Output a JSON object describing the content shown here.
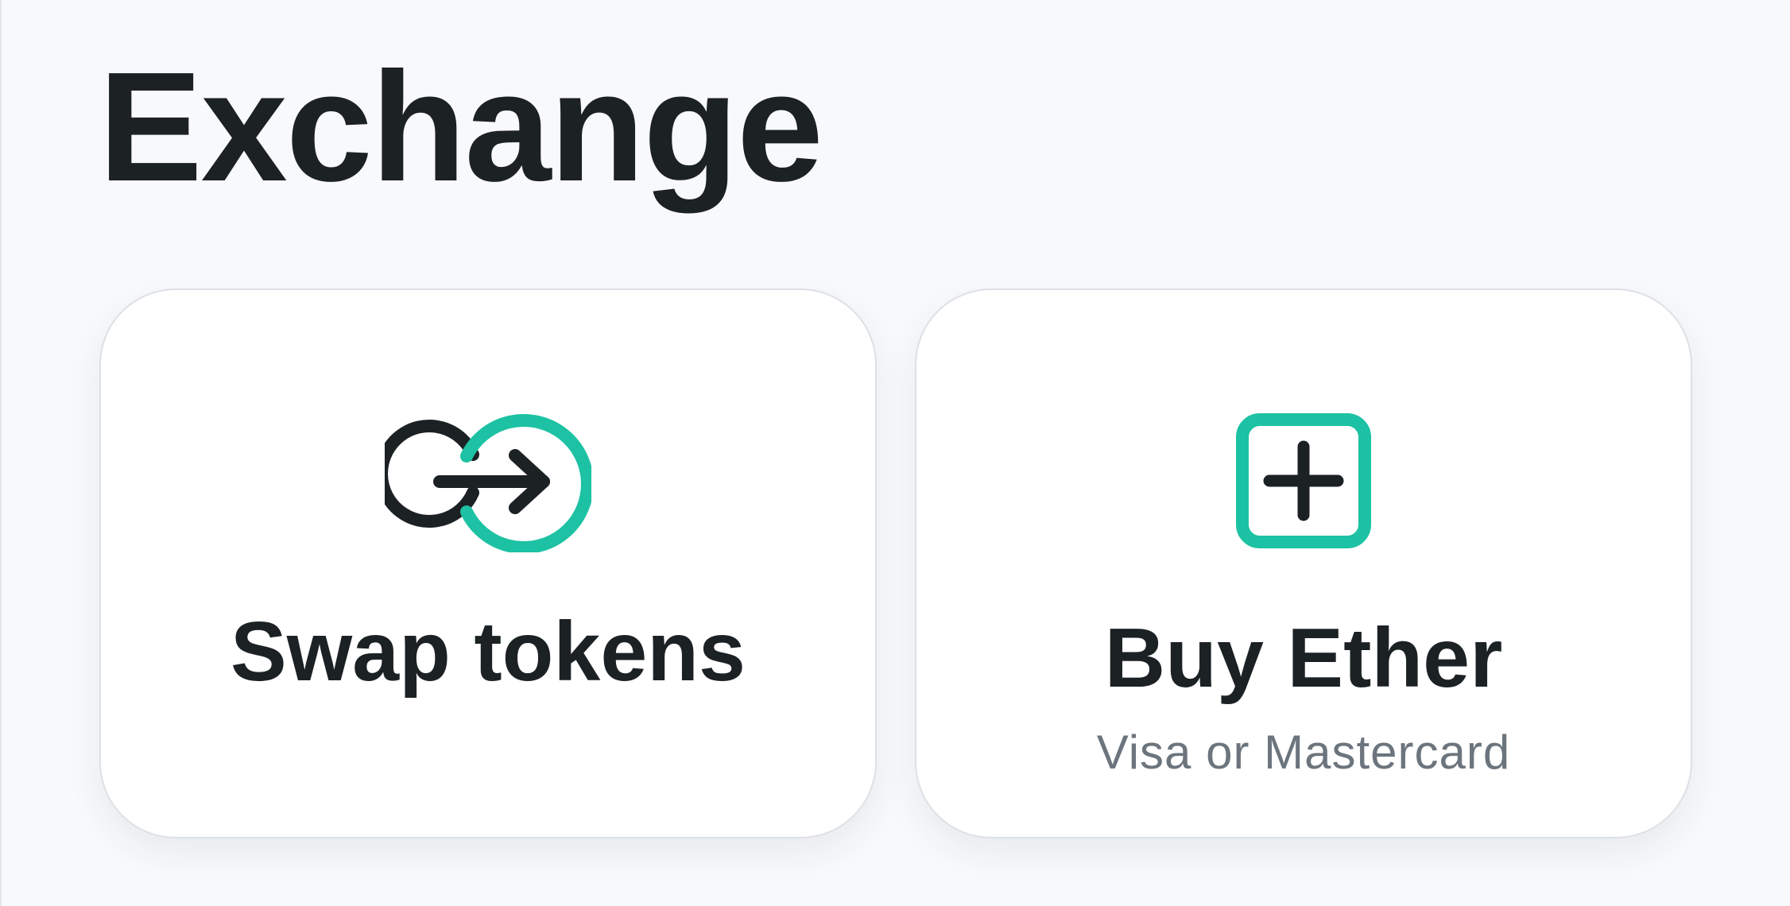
{
  "page": {
    "title": "Exchange"
  },
  "cards": {
    "swap": {
      "label": "Swap tokens",
      "icon": "swap-icon"
    },
    "buy": {
      "label": "Buy Ether",
      "sublabel": "Visa or Mastercard",
      "icon": "plus-square-icon"
    }
  },
  "colors": {
    "accent": "#1cc2a3",
    "text_primary": "#1c2124",
    "text_secondary": "#6c757d",
    "background": "#f8f9fb",
    "card_background": "#ffffff",
    "card_border": "#dde1e5"
  }
}
